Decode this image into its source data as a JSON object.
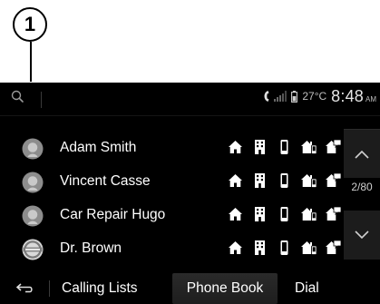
{
  "callout": {
    "number": "1"
  },
  "status_bar": {
    "temperature": "27°C",
    "time": "8:48",
    "ampm": "AM"
  },
  "contacts": [
    {
      "name": "Adam Smith",
      "avatar": "person-avatar-icon"
    },
    {
      "name": "Vincent Casse",
      "avatar": "person-avatar-icon"
    },
    {
      "name": "Car Repair Hugo",
      "avatar": "person-avatar-icon"
    },
    {
      "name": "Dr. Brown",
      "avatar": "nissan-logo-avatar"
    }
  ],
  "contact_icons": [
    "home-icon",
    "office-building-icon",
    "mobile-phone-icon",
    "work-phone-icon",
    "other-phone-icon"
  ],
  "pager": {
    "page": "2/80"
  },
  "tabs": {
    "calling_lists": "Calling Lists",
    "phone_book": "Phone Book",
    "dial": "Dial",
    "active": "Phone Book"
  },
  "colors": {
    "background": "#000000",
    "text": "#ffffff",
    "active_tab": "#262626"
  }
}
